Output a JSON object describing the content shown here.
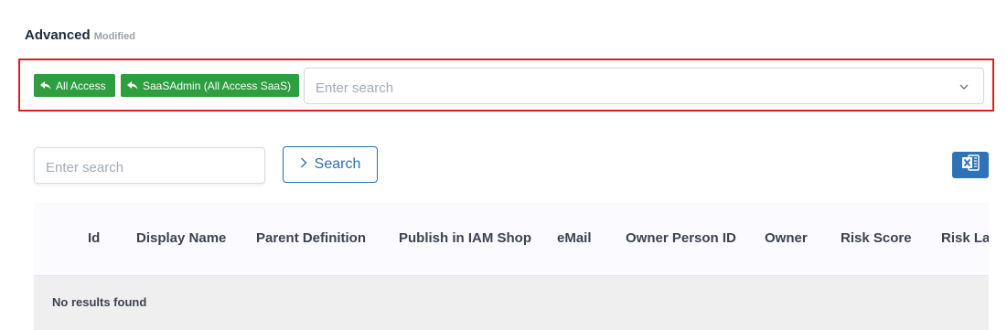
{
  "header": {
    "title": "Advanced",
    "status": "Modified"
  },
  "filter": {
    "tags": [
      {
        "label": "All Access",
        "icon": "reply-arrow-icon"
      },
      {
        "label": "SaaSAdmin (All Access SaaS)",
        "icon": "reply-arrow-icon"
      }
    ],
    "placeholder": "Enter search",
    "highlight_color": "#dc1f26"
  },
  "search": {
    "placeholder": "Enter search",
    "button_label": "Search"
  },
  "export": {
    "icon": "excel-icon"
  },
  "table": {
    "columns": [
      "Id",
      "Display Name",
      "Parent Definition",
      "Publish in IAM Shop",
      "eMail",
      "Owner Person ID",
      "Owner",
      "Risk Score",
      "Risk Last"
    ],
    "empty_message": "No results found"
  },
  "colors": {
    "tag_green": "#2e9e3f",
    "primary_blue": "#2f6eac",
    "excel_blue": "#2f73b6"
  }
}
